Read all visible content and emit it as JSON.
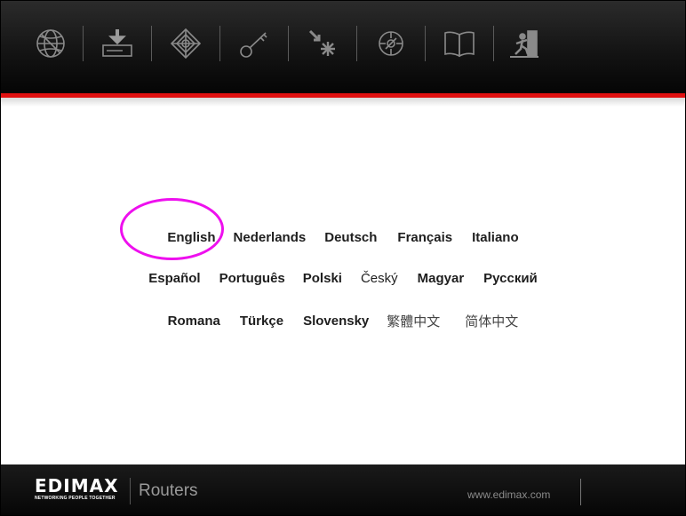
{
  "toolbar": {
    "icons": [
      "globe-icon",
      "download-icon",
      "web-icon",
      "key-icon",
      "wizard-icon",
      "compass-icon",
      "book-icon",
      "exit-icon"
    ]
  },
  "languages": {
    "row1": [
      "English",
      "Nederlands",
      "Deutsch",
      "Français",
      "Italiano"
    ],
    "row2": [
      "Español",
      "Português",
      "Polski",
      "Český",
      "Magyar",
      "Русский"
    ],
    "row3": [
      "Romana",
      "Türkçe",
      "Slovensky",
      "繁體中文",
      "简体中文"
    ]
  },
  "footer": {
    "logo_text": "EDIMAX",
    "logo_tagline": "NETWORKING PEOPLE TOGETHER",
    "product": "Routers",
    "url": "www.edimax.com"
  },
  "colors": {
    "accent_red": "#e01010",
    "highlight_magenta": "#ee10ee",
    "toolbar_bg": "#141414"
  }
}
